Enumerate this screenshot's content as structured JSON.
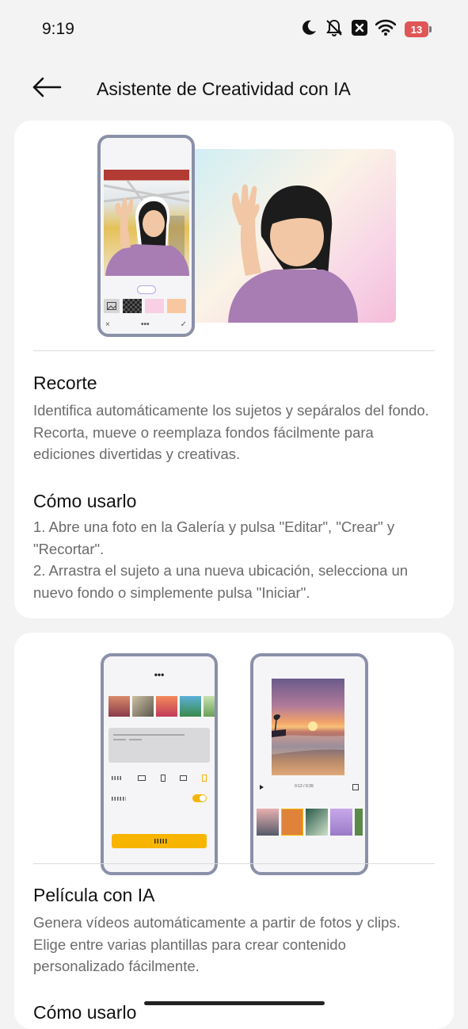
{
  "status_bar": {
    "time": "9:19",
    "battery_level": "13",
    "icons": [
      "moon-icon",
      "bell-off-icon",
      "x-box-icon",
      "wifi-icon",
      "battery-icon"
    ]
  },
  "header": {
    "title": "Asistente de Creatividad con IA",
    "back_icon": "arrow-left-icon"
  },
  "cards": [
    {
      "title": "Recorte",
      "description": "Identifica automáticamente los sujetos y sepáralos del fondo. Recorta, mueve o reemplaza fondos fácilmente para ediciones divertidas y creativas.",
      "howto_title": "Cómo usarlo",
      "steps": [
        "1. Abre una foto en la Galería y pulsa \"Editar\", \"Crear\" y \"Recortar\".",
        "2. Arrastra el sujeto a una nueva ubicación, selecciona un nuevo fondo o simplemente pulsa \"Iniciar\"."
      ],
      "mockup": {
        "editor_tools": [
          "image-icon",
          "transparent",
          "pink",
          "peach"
        ],
        "footer": [
          "×",
          "•••",
          "✓"
        ]
      }
    },
    {
      "title": "Película con IA",
      "description": "Genera vídeos automáticamente a partir de fotos y clips. Elige entre varias plantillas para crear contenido personalizado fácilmente.",
      "howto_title": "Cómo usarlo",
      "mockup": {
        "menu": "•••",
        "timecode": "0:12 / 0:39"
      }
    }
  ],
  "colors": {
    "background": "#f3f3f3",
    "card": "#ffffff",
    "phone_frame": "#8a90a8",
    "accent_yellow": "#f7b500",
    "body_text": "#6b6b6b",
    "battery": "#e05656"
  }
}
